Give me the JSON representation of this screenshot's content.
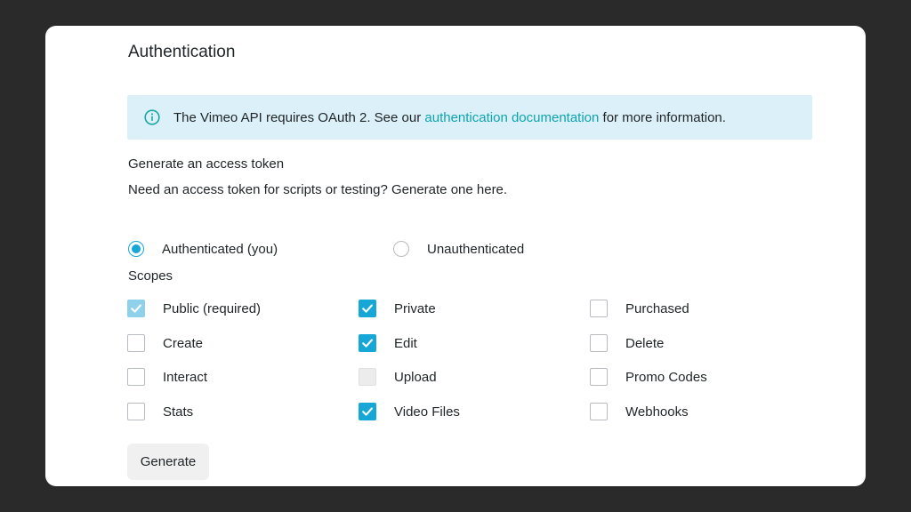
{
  "section": {
    "title": "Authentication"
  },
  "banner": {
    "icon": "info-icon",
    "text_before": "The Vimeo API requires OAuth 2. See our ",
    "link_text": "authentication documentation",
    "text_after": " for more information."
  },
  "token": {
    "title": "Generate an access token",
    "description": "Need an access token for scripts or testing? Generate one here."
  },
  "auth_mode": {
    "options": [
      {
        "label": "Authenticated (you)",
        "selected": true
      },
      {
        "label": "Unauthenticated",
        "selected": false
      }
    ]
  },
  "scopes": {
    "label": "Scopes",
    "items": [
      {
        "label": "Public (required)",
        "state": "checked-disabled"
      },
      {
        "label": "Private",
        "state": "checked"
      },
      {
        "label": "Purchased",
        "state": "unchecked"
      },
      {
        "label": "Create",
        "state": "unchecked"
      },
      {
        "label": "Edit",
        "state": "checked"
      },
      {
        "label": "Delete",
        "state": "unchecked"
      },
      {
        "label": "Interact",
        "state": "unchecked"
      },
      {
        "label": "Upload",
        "state": "disabled"
      },
      {
        "label": "Promo Codes",
        "state": "unchecked"
      },
      {
        "label": "Stats",
        "state": "unchecked"
      },
      {
        "label": "Video Files",
        "state": "checked"
      },
      {
        "label": "Webhooks",
        "state": "unchecked"
      }
    ]
  },
  "actions": {
    "generate_label": "Generate"
  },
  "colors": {
    "accent": "#17a7d7",
    "link": "#0fa3b1",
    "banner_bg": "#dcf0f9"
  }
}
